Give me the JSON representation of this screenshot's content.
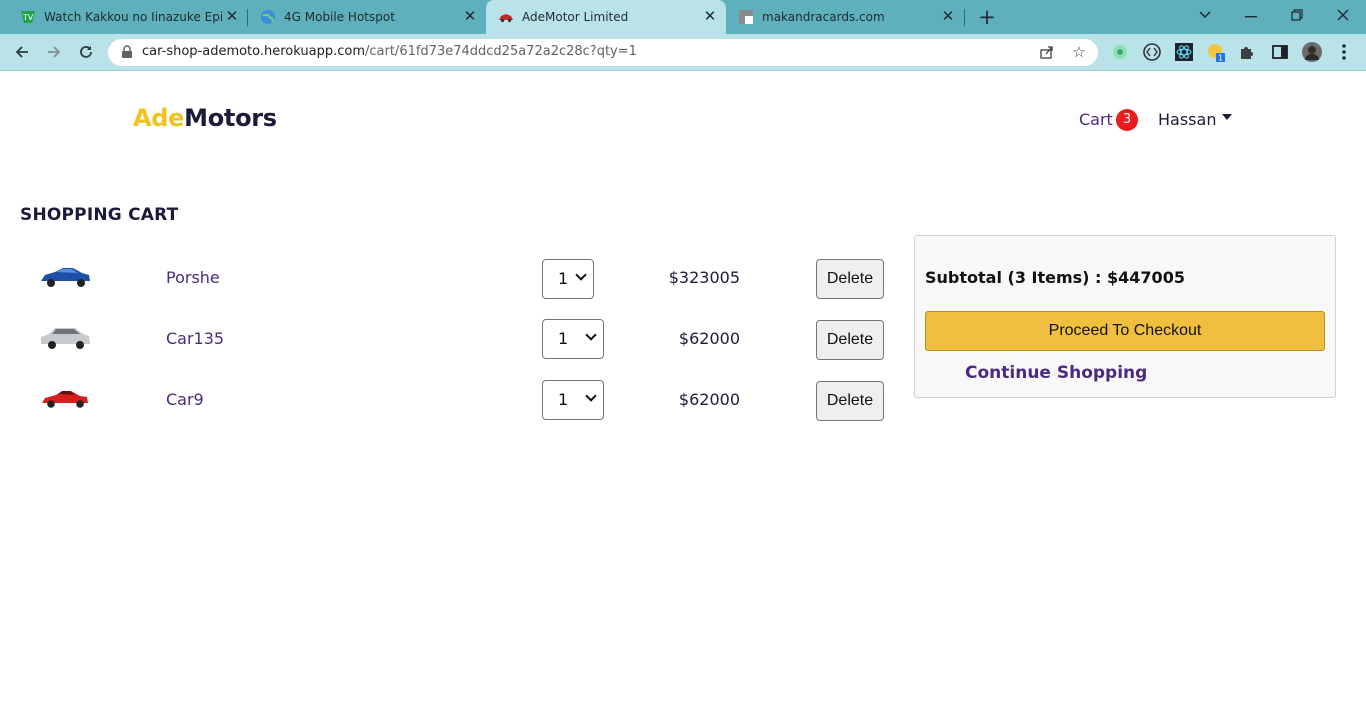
{
  "browser": {
    "tabs": [
      {
        "title": "Watch Kakkou no Iinazuke Episod",
        "favicon": "tv-icon",
        "active": false
      },
      {
        "title": "4G Mobile Hotspot",
        "favicon": "globe-icon",
        "active": false
      },
      {
        "title": "AdeMotor Limited",
        "favicon": "car-icon",
        "active": true
      },
      {
        "title": "makandracards.com",
        "favicon": "page-icon",
        "active": false
      }
    ],
    "url_host": "car-shop-ademoto.herokuapp.com",
    "url_path": "/cart/61fd73e74ddcd25a72a2c28c?qty=1",
    "extension_badge": "1"
  },
  "header": {
    "brand_part1": "Ade",
    "brand_part2": "Motors",
    "cart_label": "Cart",
    "cart_count": "3",
    "user_name": "Hassan"
  },
  "cart": {
    "heading": "SHOPPING CART",
    "items": [
      {
        "name": "Porshe",
        "qty": "1",
        "price": "$323005",
        "delete_label": "Delete",
        "image": "blue-convertible-car"
      },
      {
        "name": "Car135",
        "qty": "1",
        "price": "$62000",
        "delete_label": "Delete",
        "image": "silver-suv-car"
      },
      {
        "name": "Car9",
        "qty": "1",
        "price": "$62000",
        "delete_label": "Delete",
        "image": "red-sports-car"
      }
    ]
  },
  "summary": {
    "subtotal": "Subtotal (3 Items) : $447005",
    "checkout_label": "Proceed To Checkout",
    "continue_label": "Continue Shopping"
  },
  "colors": {
    "brand_yellow": "#f2c31b",
    "brand_dark": "#1c1c3a",
    "link_purple": "#4b2a80",
    "badge_red": "#ea1c1c",
    "checkout_yellow": "#f0bf3f",
    "chrome_teal": "#5fb0bd"
  }
}
